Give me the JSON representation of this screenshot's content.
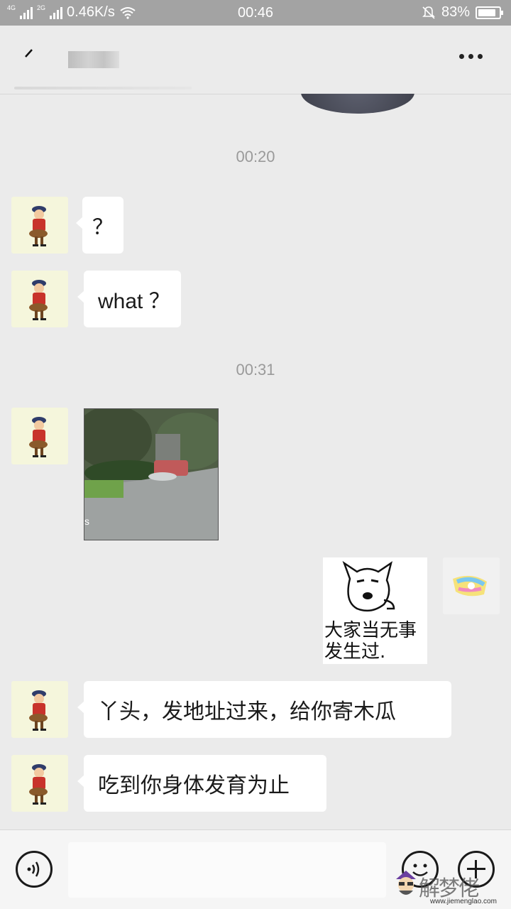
{
  "status_bar": {
    "network_4g": "4G",
    "network_2g": "2G",
    "speed": "0.46K/s",
    "time": "00:46",
    "battery": "83%"
  },
  "header": {
    "more_icon": "more-dots-icon",
    "back_icon": "back-arrow-icon"
  },
  "messages": [
    {
      "type": "timestamp",
      "text": "00:20"
    },
    {
      "type": "text",
      "side": "left",
      "text": "？"
    },
    {
      "type": "text",
      "side": "left",
      "text": "what ？"
    },
    {
      "type": "timestamp",
      "text": "00:31"
    },
    {
      "type": "video",
      "side": "left",
      "caption": "s"
    },
    {
      "type": "sticker",
      "side": "right",
      "text_line1": "大家当无事",
      "text_line2": "发生过."
    },
    {
      "type": "text",
      "side": "left",
      "text": "丫头，发地址过来，给你寄木瓜"
    },
    {
      "type": "text",
      "side": "left",
      "text": "吃到你身体发育为止"
    }
  ],
  "input_bar": {
    "voice_icon": "voice-icon",
    "emoji_icon": "emoji-icon",
    "plus_icon": "plus-icon"
  },
  "watermark": {
    "main": "解梦佬",
    "url": "www.jiemenglao.com"
  },
  "colors": {
    "status_bar": "#a3a3a3",
    "background": "#ebebeb",
    "bubble": "#ffffff",
    "timestamp": "#9a9a9a"
  }
}
